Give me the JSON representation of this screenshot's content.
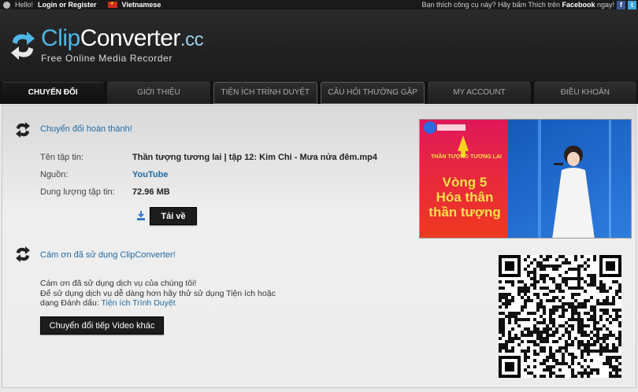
{
  "topbar": {
    "hello": "Hello!",
    "login": "Login or Register",
    "language": "Vietnamese",
    "promo_prefix": "Bạn thích công cụ này? Hãy bấm Thích trên ",
    "promo_brand": "Facebook",
    "promo_suffix": " ngay!",
    "fb_glyph": "f",
    "tw_glyph": "t"
  },
  "header": {
    "logo_part1": "Clip",
    "logo_part2": "Converter",
    "logo_part3": ".cc",
    "subtitle": "Free Online Media Recorder"
  },
  "nav": {
    "tabs": [
      {
        "label": "CHUYỂN ĐỔI"
      },
      {
        "label": "GIỚI THIỆU"
      },
      {
        "label": "TIỆN ÍCH TRÌNH DUYỆT"
      },
      {
        "label": "CÂU HỎI THƯỜNG GẶP"
      },
      {
        "label": "MY ACCOUNT"
      },
      {
        "label": "ĐIỀU KHOẢN"
      }
    ]
  },
  "result": {
    "title": "Chuyển đổi hoàn thành!",
    "filename_label": "Tên tập tin:",
    "filename_value": "Thần tượng tương lai | tập 12: Kim Chi - Mưa nửa đêm.mp4",
    "source_label": "Nguồn:",
    "source_value": "YouTube",
    "size_label": "Dung lượng tập tin:",
    "size_value": "72.96 MB",
    "download_label": "Tải về"
  },
  "thanks": {
    "title": "Cám ơn đã sử dụng ClipConverter!",
    "line1": "Cám ơn đã sử dụng dịch vụ của chúng tôi!",
    "line2": "Để sử dụng dịch vụ dễ dàng hơn hãy thử sử dụng Tiện ích hoặc",
    "line3_prefix": "dạng Đánh dấu: ",
    "line3_link": "Tiện ích Trình Duyệt",
    "more_button": "Chuyển đổi tiếp Video khác"
  },
  "thumbnail": {
    "show_title": "THẦN TƯỢNG TƯƠNG LAI",
    "line1": "Vòng 5",
    "line2": "Hóa thân",
    "line3": "thần tượng"
  },
  "colors": {
    "link": "#1f6aa5",
    "logo_blue": "#4fb6e8"
  }
}
